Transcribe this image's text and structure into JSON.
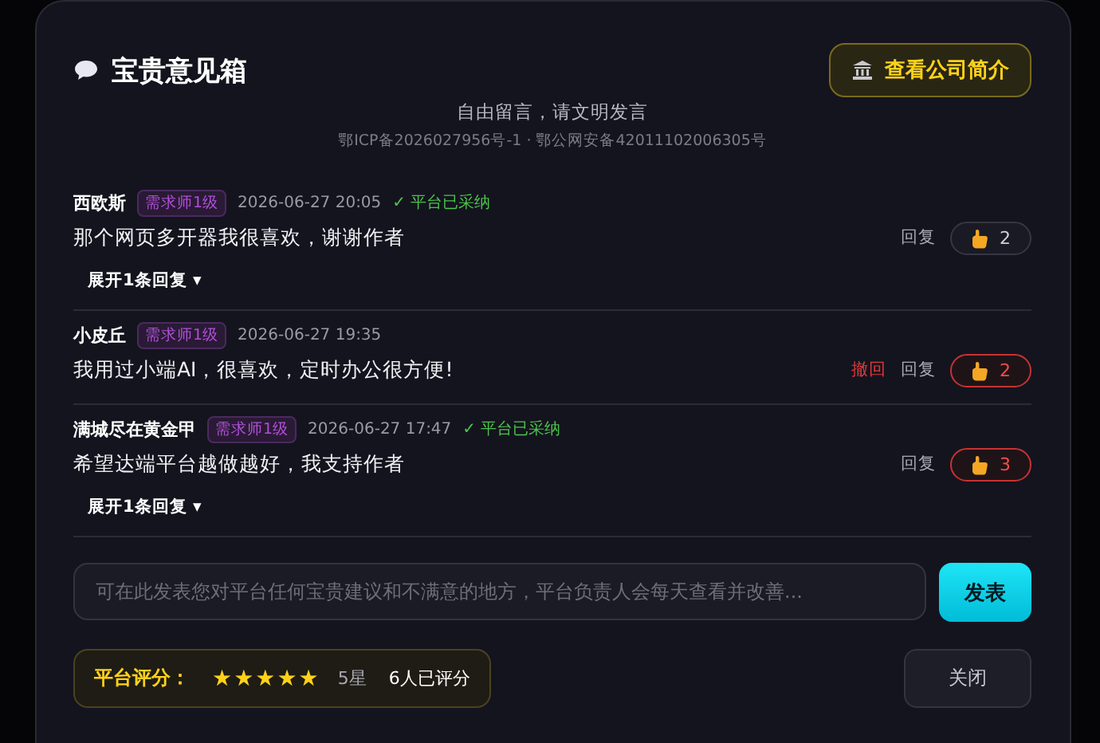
{
  "header": {
    "title": "宝贵意见箱",
    "company_button": "查看公司简介"
  },
  "subtitle": "自由留言，请文明发言",
  "license": "鄂ICP备2026027956号-1 · 鄂公网安备42011102006305号",
  "comments": [
    {
      "name": "西欧斯",
      "badge": "需求师1级",
      "time": "2026-06-27 20:05",
      "adopted": "✓ 平台已采纳",
      "text": "那个网页多开器我很喜欢，谢谢作者",
      "reply": "回复",
      "likes": "2",
      "liked": false,
      "expand": "展开1条回复 ▾"
    },
    {
      "name": "小皮丘",
      "badge": "需求师1级",
      "time": "2026-06-27 19:35",
      "text": "我用过小端AI，很喜欢，定时办公很方便!",
      "retract": "撤回",
      "reply": "回复",
      "likes": "2",
      "liked": true
    },
    {
      "name": "满城尽在黄金甲",
      "badge": "需求师1级",
      "time": "2026-06-27 17:47",
      "adopted": "✓ 平台已采纳",
      "text": "希望达端平台越做越好，我支持作者",
      "reply": "回复",
      "likes": "3",
      "liked": true,
      "expand": "展开1条回复 ▾"
    }
  ],
  "input": {
    "placeholder": "可在此发表您对平台任何宝贵建议和不满意的地方，平台负责人会每天查看并改善..."
  },
  "post_button": "发表",
  "rating": {
    "label": "平台评分：",
    "star": "★",
    "stars": 5,
    "score": "5星",
    "count": "6人已评分"
  },
  "close_button": "关闭"
}
